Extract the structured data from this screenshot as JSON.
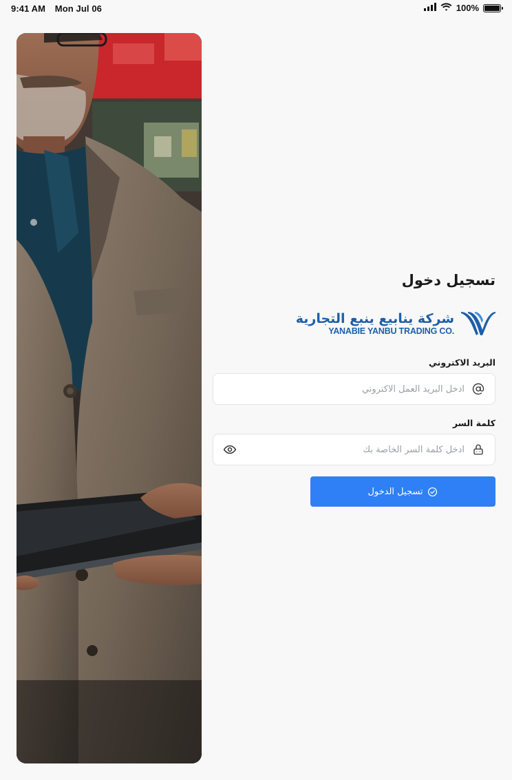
{
  "status_bar": {
    "time": "9:41 AM",
    "date": "Mon Jul 06",
    "battery": "100%",
    "icons": [
      "signal-icon",
      "wifi-icon",
      "battery-icon"
    ]
  },
  "hero": {
    "image": "man-holding-tablet-photo"
  },
  "login": {
    "title": "تسجيل دخول",
    "logo": {
      "arabic": "شركة ينابيع ينبع التجارية",
      "english": "YANABIE YANBU TRADING CO."
    },
    "email": {
      "label": "البريد الاكتروني",
      "placeholder": "ادخل البريد العمل الاكتروني",
      "value": "",
      "icon": "at-sign-icon"
    },
    "password": {
      "label": "كلمة السر",
      "placeholder": "ادخل كلمة السر الخاصة بك",
      "value": "",
      "icon": "lock-icon",
      "toggle_icon": "eye-icon"
    },
    "submit": {
      "label": "تسجيل الدخول",
      "icon": "check-circle-icon"
    }
  },
  "colors": {
    "primary": "#2f80f6",
    "brand": "#1d5fa8",
    "background": "#f8f8f9"
  }
}
